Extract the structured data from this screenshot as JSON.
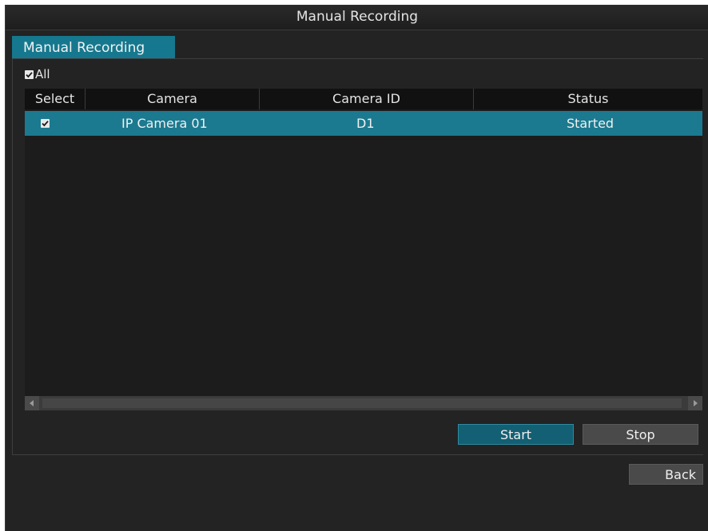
{
  "window": {
    "title": "Manual Recording"
  },
  "tab": {
    "label": "Manual Recording"
  },
  "select_all": {
    "label": "All",
    "checked": true
  },
  "table": {
    "columns": [
      "Select",
      "Camera",
      "Camera ID",
      "Status"
    ],
    "rows": [
      {
        "selected": true,
        "camera": "IP Camera 01",
        "camera_id": "D1",
        "status": "Started"
      }
    ]
  },
  "buttons": {
    "start": "Start",
    "stop": "Stop",
    "back": "Back"
  },
  "colors": {
    "accent": "#16788e",
    "selected_row": "#1b7a90",
    "background": "#232323"
  },
  "icons": {
    "checkbox": "checkmark-icon",
    "scroll_left": "arrow-left-icon",
    "scroll_right": "arrow-right-icon"
  }
}
